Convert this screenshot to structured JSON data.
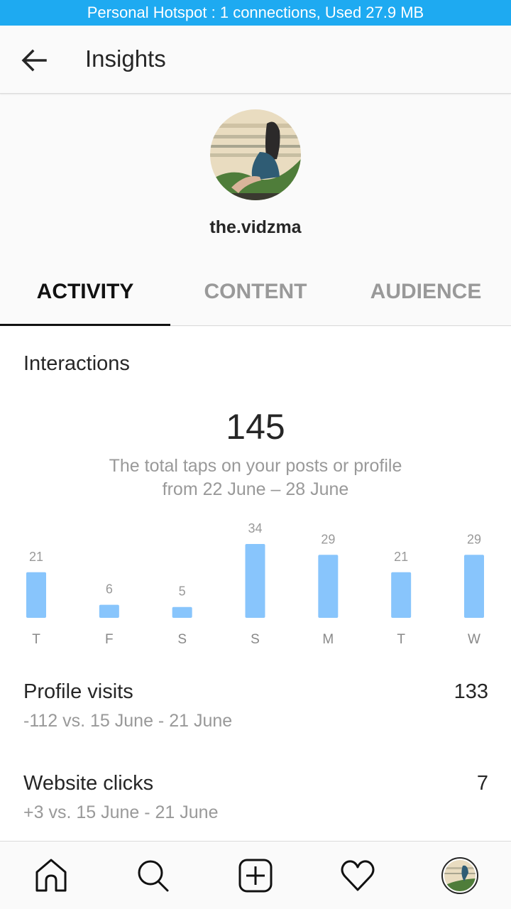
{
  "status_bar": {
    "text": "Personal Hotspot : 1 connections, Used 27.9 MB"
  },
  "header": {
    "title": "Insights",
    "back_icon": "arrow-left-icon"
  },
  "profile": {
    "username": "the.vidzma"
  },
  "tabs": [
    {
      "label": "ACTIVITY",
      "active": true
    },
    {
      "label": "CONTENT",
      "active": false
    },
    {
      "label": "AUDIENCE",
      "active": false
    }
  ],
  "interactions": {
    "title": "Interactions",
    "total": "145",
    "description_line1": "The total taps on your posts or profile",
    "description_line2": "from 22 June – 28 June"
  },
  "chart_data": {
    "type": "bar",
    "title": "Interactions",
    "categories": [
      "T",
      "F",
      "S",
      "S",
      "M",
      "T",
      "W"
    ],
    "values": [
      21,
      6,
      5,
      34,
      29,
      21,
      29
    ],
    "xlabel": "",
    "ylabel": "",
    "bar_color": "#88c5fc",
    "data_labels": true,
    "grid": false
  },
  "metrics": [
    {
      "label": "Profile visits",
      "value": "133",
      "comparison": "-112 vs. 15 June - 21 June"
    },
    {
      "label": "Website clicks",
      "value": "7",
      "comparison": "+3 vs. 15 June - 21 June"
    }
  ],
  "bottom_nav": [
    {
      "name": "home",
      "icon": "home-icon"
    },
    {
      "name": "search",
      "icon": "search-icon"
    },
    {
      "name": "new-post",
      "icon": "plus-square-icon"
    },
    {
      "name": "activity",
      "icon": "heart-icon"
    },
    {
      "name": "profile",
      "icon": "avatar"
    }
  ],
  "colors": {
    "status_bar": "#1eaaf1",
    "bar": "#88c5fc",
    "muted_text": "#999999",
    "primary_text": "#262626"
  }
}
